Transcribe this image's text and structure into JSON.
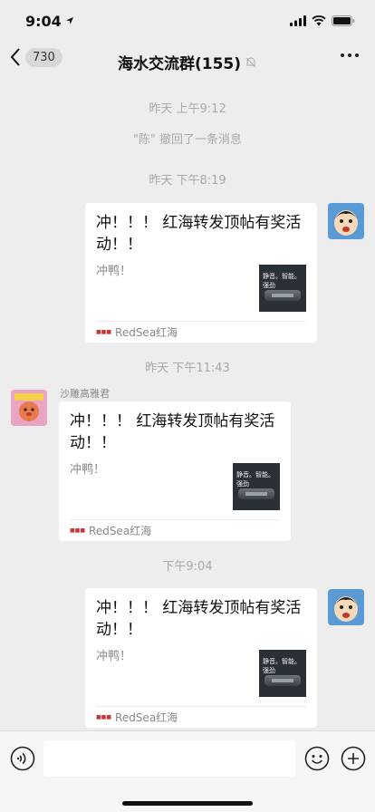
{
  "status_bar": {
    "time": "9:04"
  },
  "nav": {
    "back_count": "730",
    "title": "海水交流群(155)"
  },
  "messages": {
    "time1": "昨天 上午9:12",
    "recall_notice": "\"陈\" 撤回了一条消息",
    "time2": "昨天 下午8:19",
    "time3": "昨天 下午11:43",
    "sender_name": "沙雕高雅君",
    "time4": "下午9:04"
  },
  "card": {
    "title": "冲！！！ 红海转发顶帖有奖活动！！",
    "desc": "冲鸭！",
    "source": "RedSea红海",
    "thumb_text": "静音。智能。强劲"
  }
}
